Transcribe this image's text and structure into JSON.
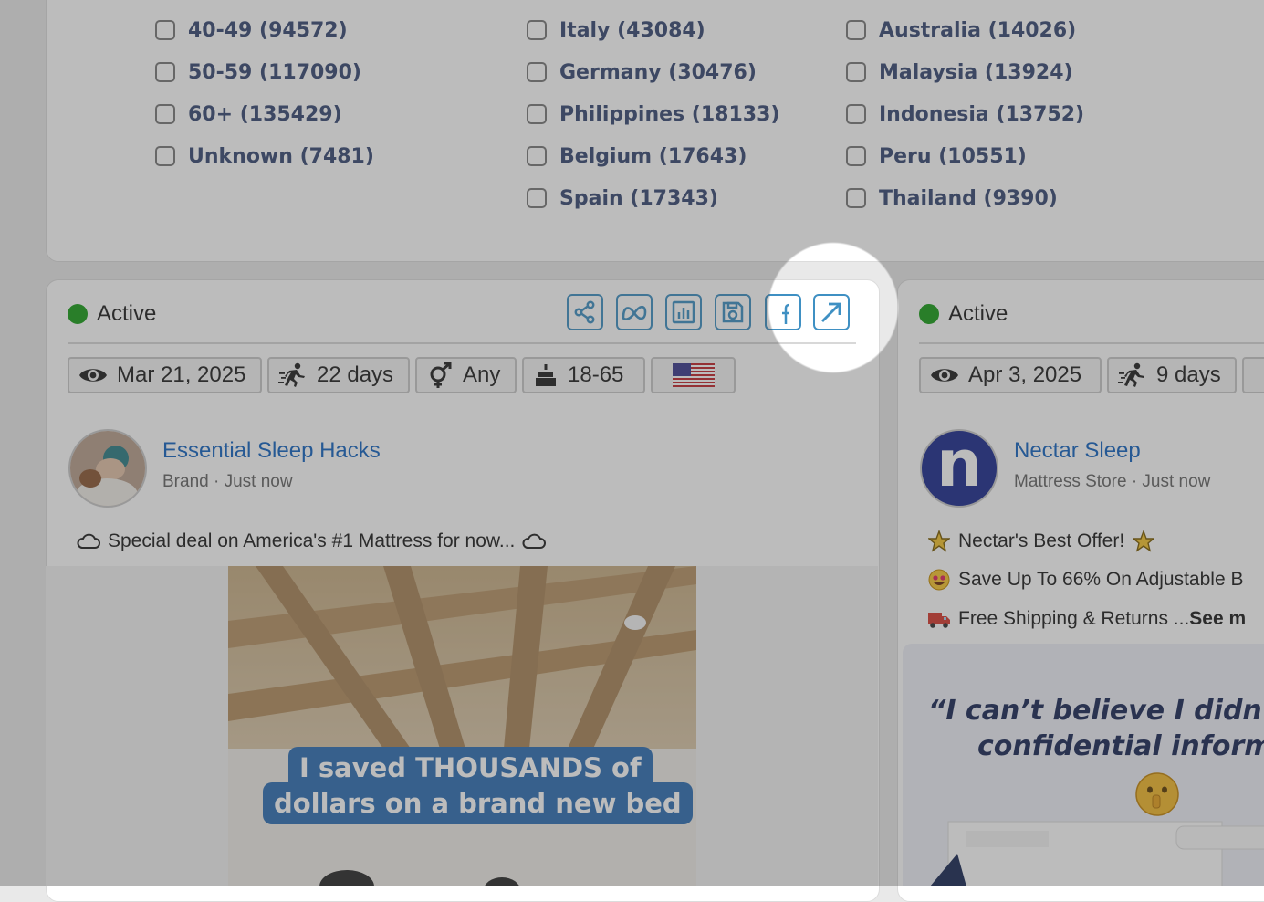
{
  "filters": {
    "age": [
      "40-49 (94572)",
      "50-59 (117090)",
      "60+ (135429)",
      "Unknown (7481)"
    ],
    "country_col1": [
      "Italy (43084)",
      "Germany (30476)",
      "Philippines (18133)",
      "Belgium (17643)",
      "Spain (17343)"
    ],
    "country_col2": [
      "Australia (14026)",
      "Malaysia (13924)",
      "Indonesia (13752)",
      "Peru (10551)",
      "Thailand (9390)"
    ]
  },
  "ad1": {
    "status": "Active",
    "date": "Mar 21, 2025",
    "duration": "22 days",
    "gender": "Any",
    "age": "18-65",
    "page_name": "Essential Sleep Hacks",
    "page_sub": "Brand · Just now",
    "text": "Special deal on America's #1 Mattress for now...",
    "image_caption_1": "I saved THOUSANDS of",
    "image_caption_2": "dollars on a brand new bed"
  },
  "ad2": {
    "status": "Active",
    "date": "Apr 3, 2025",
    "duration": "9 days",
    "page_name": "Nectar Sleep",
    "avatar_letter": "n",
    "page_sub": "Mattress Store · Just now",
    "line1": "Nectar's Best Offer!",
    "line2": "Save Up To 66% On Adjustable B",
    "line3": "Free Shipping & Returns ... ",
    "see_more": "See m",
    "image_quote_1": "“I can’t believe I didn’t k",
    "image_quote_2": "confidential informa"
  },
  "colors": {
    "accent": "#3f90c3",
    "status_green": "#1a9e1a",
    "link_blue": "#1565c0",
    "filter_text": "#394a74"
  }
}
